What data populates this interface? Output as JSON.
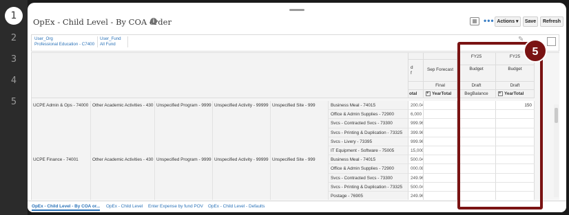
{
  "steps": [
    "1",
    "2",
    "3",
    "4",
    "5"
  ],
  "header": {
    "title": "OpEx - Child Level - By COA order",
    "actions_label": "Actions ▾",
    "save_label": "Save",
    "refresh_label": "Refresh",
    "more_label": "•••"
  },
  "pov": {
    "org_label": "User_Org",
    "org_value": "Professional Education - C7400",
    "fund_label": "User_Fund",
    "fund_value": "All Fund"
  },
  "columns": {
    "partial_top": "d",
    "partial_mid": "f",
    "partial_total": "otal",
    "sep_forecast": "Sep Forecast",
    "final": "Final",
    "year_total": "YearTotal",
    "fy_a": "FY25",
    "fy_b": "FY25",
    "budget_a": "Budget",
    "budget_b": "Budget",
    "draft_a": "Draft",
    "draft_b": "Draft",
    "beg_balance": "BegBalance",
    "year_total_b": "YearTotal",
    "plus": "+"
  },
  "rows": [
    {
      "entity": "UCPE Admin & Ops - 74000",
      "activity_group": "Other Academic Activities - 430",
      "program": "Unspecified Program - 9999",
      "activity": "Unspecified Activity - 99999",
      "site": "Unspecified Site - 999",
      "account": "Business Meal - 74015",
      "value": "200.04",
      "edit": "150"
    },
    {
      "entity": "",
      "activity_group": "",
      "program": "",
      "activity": "",
      "site": "",
      "account": "Office & Admin Supplies - 72900",
      "value": "6,000",
      "edit": ""
    },
    {
      "entity": "",
      "activity_group": "",
      "program": "",
      "activity": "",
      "site": "",
      "account": "Svcs - Contracted Svcs - 73300",
      "value": "999.96",
      "edit": ""
    },
    {
      "entity": "",
      "activity_group": "",
      "program": "",
      "activity": "",
      "site": "",
      "account": "Svcs - Printing & Duplication - 73325",
      "value": "399.96",
      "edit": ""
    },
    {
      "entity": "",
      "activity_group": "",
      "program": "",
      "activity": "",
      "site": "",
      "account": "Svcs - Livery - 73395",
      "value": "999.96",
      "edit": ""
    },
    {
      "entity": "",
      "activity_group": "",
      "program": "",
      "activity": "",
      "site": "",
      "account": "IT Equipment - Software - 75005",
      "value": "15,000",
      "edit": ""
    },
    {
      "entity": "UCPE Finance - 74001",
      "activity_group": "Other Academic Activities - 430",
      "program": "Unspecified Program - 9999",
      "activity": "Unspecified Activity - 99999",
      "site": "Unspecified Site - 999",
      "account": "Business Meal - 74015",
      "value": "500.04",
      "edit": ""
    },
    {
      "entity": "",
      "activity_group": "",
      "program": "",
      "activity": "",
      "site": "",
      "account": "Office & Admin Supplies - 72900",
      "value": "000.08",
      "edit": ""
    },
    {
      "entity": "",
      "activity_group": "",
      "program": "",
      "activity": "",
      "site": "",
      "account": "Svcs - Contracted Svcs - 73300",
      "value": "249.96",
      "edit": ""
    },
    {
      "entity": "",
      "activity_group": "",
      "program": "",
      "activity": "",
      "site": "",
      "account": "Svcs - Printing & Duplication - 73325",
      "value": "500.04",
      "edit": ""
    },
    {
      "entity": "",
      "activity_group": "",
      "program": "",
      "activity": "",
      "site": "",
      "account": "Postage - 76905",
      "value": "249.96",
      "edit": ""
    }
  ],
  "tabs": [
    "OpEx - Child Level - By COA or...",
    "OpEx - Child Level",
    "Enter Expense by fund POV",
    "OpEx - Child Level - Defaults"
  ],
  "callout": {
    "number": "5",
    "color": "#7a1313"
  }
}
